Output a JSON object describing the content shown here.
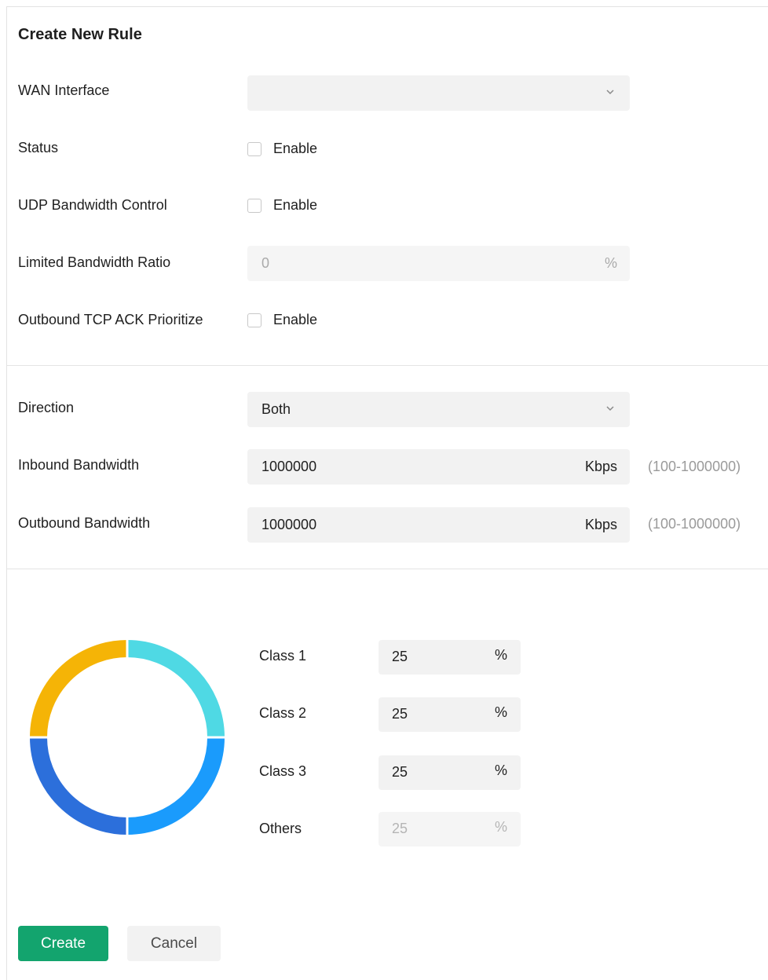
{
  "form": {
    "title": "Create New Rule",
    "wan_interface": {
      "label": "WAN Interface",
      "value": ""
    },
    "status": {
      "label": "Status",
      "checkbox_label": "Enable",
      "checked": false
    },
    "udp_bandwidth_control": {
      "label": "UDP Bandwidth Control",
      "checkbox_label": "Enable",
      "checked": false
    },
    "limited_bandwidth_ratio": {
      "label": "Limited Bandwidth Ratio",
      "value": "0",
      "unit": "%"
    },
    "outbound_tcp_ack": {
      "label": "Outbound TCP ACK Prioritize",
      "checkbox_label": "Enable",
      "checked": false
    },
    "direction": {
      "label": "Direction",
      "value": "Both"
    },
    "inbound_bandwidth": {
      "label": "Inbound Bandwidth",
      "value": "1000000",
      "unit": "Kbps",
      "range": "(100-1000000)"
    },
    "outbound_bandwidth": {
      "label": "Outbound Bandwidth",
      "value": "1000000",
      "unit": "Kbps",
      "range": "(100-1000000)"
    }
  },
  "classes": [
    {
      "label": "Class 1",
      "value": "25",
      "unit": "%",
      "color": "#4fd9e4",
      "editable": true
    },
    {
      "label": "Class 2",
      "value": "25",
      "unit": "%",
      "color": "#1a9bfc",
      "editable": true
    },
    {
      "label": "Class 3",
      "value": "25",
      "unit": "%",
      "color": "#2c6fdb",
      "editable": true
    },
    {
      "label": "Others",
      "value": "25",
      "unit": "%",
      "color": "#f5b406",
      "editable": false
    }
  ],
  "buttons": {
    "create": "Create",
    "cancel": "Cancel"
  },
  "colors": {
    "primary": "#13a46e",
    "field_bg": "#f2f2f2"
  }
}
